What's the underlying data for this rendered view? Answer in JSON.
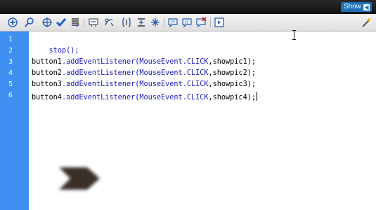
{
  "topbar": {
    "show_label": "Show"
  },
  "toolbar": {
    "icons": [
      "add-statement-icon",
      "find-icon",
      "target-insertion-icon",
      "check-syntax-icon",
      "auto-format-icon",
      "code-hint-icon",
      "debug-options-icon",
      "collapse-between-braces-icon",
      "collapse-selection-icon",
      "expand-all-icon",
      "apply-block-comment-icon",
      "apply-line-comment-icon",
      "remove-comment-icon",
      "show-hide-toolbox-icon",
      "script-assist-icon"
    ]
  },
  "editor": {
    "line_numbers": [
      "1",
      "2",
      "3",
      "4",
      "5",
      "6"
    ],
    "lines": [
      {
        "plain": "stop();"
      },
      {
        "plain": ""
      },
      {
        "obj": "button1",
        "method": ".addEventListener(",
        "cls": "MouseEvent",
        "const": ".CLICK",
        "rest": ",showpic1);"
      },
      {
        "obj": "button2",
        "method": ".addEventListener(",
        "cls": "MouseEvent",
        "const": ".CLICK",
        "rest": ",showpic2);"
      },
      {
        "obj": "button3",
        "method": ".addEventListener(",
        "cls": "MouseEvent",
        "const": ".CLICK",
        "rest": ",showpic3);"
      },
      {
        "obj": "button4",
        "method": ".addEventListener(",
        "cls": "MouseEvent",
        "const": ".CLICK",
        "rest": ",showpic4);"
      }
    ]
  },
  "colors": {
    "gutter": "#3f8ef2",
    "keyword": "#1a1ab8",
    "topbar": "#111111",
    "show_button": "#1e6fb8"
  }
}
